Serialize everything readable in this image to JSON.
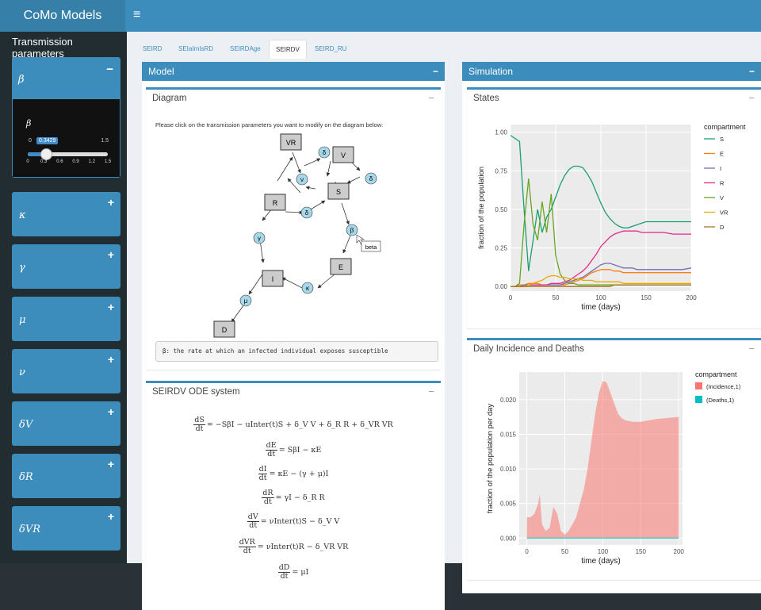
{
  "app": {
    "title": "CoMo Models",
    "menu_icon": "hamburger-icon"
  },
  "sidebar": {
    "title": "Transmission parameters",
    "beta": {
      "symbol": "β",
      "toggle": "−",
      "slider": {
        "label": "β",
        "min": "0",
        "max": "1.5",
        "value": 0.3429,
        "value_label": "0.3429",
        "ticks": [
          "0",
          "0.3",
          "0.6",
          "0.9",
          "1.2",
          "1.5"
        ]
      }
    },
    "params": [
      {
        "symbol": "κ",
        "toggle": "+"
      },
      {
        "symbol": "γ",
        "toggle": "+"
      },
      {
        "symbol": "μ",
        "toggle": "+"
      },
      {
        "symbol": "ν",
        "toggle": "+"
      },
      {
        "symbol": "δV",
        "toggle": "+"
      },
      {
        "symbol": "δR",
        "toggle": "+"
      },
      {
        "symbol": "δVR",
        "toggle": "+"
      }
    ]
  },
  "tabs": [
    {
      "label": "SEIRD",
      "active": false
    },
    {
      "label": "SEIaImIsRD",
      "active": false
    },
    {
      "label": "SEIRDAge",
      "active": false
    },
    {
      "label": "SEIRDV",
      "active": true
    },
    {
      "label": "SEIRD_RU",
      "active": false
    }
  ],
  "model": {
    "title": "Model",
    "toggle": "−",
    "diagram": {
      "title": "Diagram",
      "toggle": "−",
      "prompt": "Please click on the transmission parameters you want to modify on the diagram below:",
      "nodes": [
        "VR",
        "V",
        "S",
        "R",
        "E",
        "I",
        "D"
      ],
      "params": [
        "δ",
        "δ",
        "ν",
        "δ",
        "β",
        "γ",
        "κ",
        "μ"
      ],
      "tooltip": "beta",
      "description": "β: the rate at which an infected individual exposes susceptible"
    },
    "ode": {
      "title": "SEIRDV ODE system",
      "toggle": "−",
      "equations": [
        {
          "num": "dS",
          "den": "dt",
          "rhs": "= −SβI − uInter(t)S + δ_V V + δ_R R + δ_VR VR"
        },
        {
          "num": "dE",
          "den": "dt",
          "rhs": "= SβI − κE"
        },
        {
          "num": "dI",
          "den": "dt",
          "rhs": "= κE − (γ + μ)I"
        },
        {
          "num": "dR",
          "den": "dt",
          "rhs": "= γI − δ_R R"
        },
        {
          "num": "dV",
          "den": "dt",
          "rhs": "= νInter(t)S − δ_V V"
        },
        {
          "num": "dVR",
          "den": "dt",
          "rhs": "= νInter(t)R − δ_VR VR"
        },
        {
          "num": "dD",
          "den": "dt",
          "rhs": "= μI"
        }
      ]
    }
  },
  "simulation": {
    "title": "Simulation",
    "toggle": "−"
  },
  "chart_data": [
    {
      "type": "line",
      "title": "States",
      "xlabel": "time (days)",
      "ylabel": "fraction of the population",
      "xlim": [
        0,
        200
      ],
      "ylim": [
        -0.03,
        1.05
      ],
      "xticks": [
        "0",
        "50",
        "100",
        "150",
        "200"
      ],
      "yticks": [
        "0.00",
        "0.25",
        "0.50",
        "0.75",
        "1.00"
      ],
      "legend_title": "compartment",
      "legend_position": "right",
      "grid": true,
      "x": [
        0,
        5,
        10,
        15,
        20,
        25,
        30,
        35,
        40,
        45,
        50,
        55,
        60,
        65,
        70,
        75,
        80,
        85,
        90,
        95,
        100,
        105,
        110,
        115,
        120,
        125,
        130,
        135,
        140,
        145,
        150,
        160,
        170,
        180,
        190,
        200
      ],
      "series": [
        {
          "name": "S",
          "color": "#1b9e77",
          "values": [
            0.98,
            0.96,
            0.94,
            0.5,
            0.1,
            0.3,
            0.5,
            0.35,
            0.45,
            0.5,
            0.58,
            0.66,
            0.72,
            0.76,
            0.78,
            0.78,
            0.77,
            0.73,
            0.68,
            0.61,
            0.54,
            0.48,
            0.44,
            0.41,
            0.39,
            0.38,
            0.38,
            0.39,
            0.4,
            0.41,
            0.42,
            0.42,
            0.42,
            0.42,
            0.42,
            0.42
          ]
        },
        {
          "name": "E",
          "color": "#ff7f0e",
          "values": [
            0.0,
            0.0,
            0.01,
            0.01,
            0.02,
            0.02,
            0.02,
            0.01,
            0.01,
            0.01,
            0.01,
            0.01,
            0.01,
            0.02,
            0.03,
            0.04,
            0.05,
            0.07,
            0.09,
            0.1,
            0.11,
            0.11,
            0.11,
            0.1,
            0.1,
            0.09,
            0.09,
            0.09,
            0.09,
            0.09,
            0.09,
            0.09,
            0.09,
            0.09,
            0.09,
            0.09
          ]
        },
        {
          "name": "I",
          "color": "#7570b3",
          "values": [
            0.0,
            0.0,
            0.0,
            0.01,
            0.01,
            0.01,
            0.01,
            0.01,
            0.01,
            0.01,
            0.01,
            0.01,
            0.02,
            0.03,
            0.04,
            0.05,
            0.06,
            0.08,
            0.1,
            0.12,
            0.14,
            0.15,
            0.15,
            0.14,
            0.13,
            0.12,
            0.12,
            0.12,
            0.11,
            0.11,
            0.11,
            0.11,
            0.11,
            0.11,
            0.11,
            0.12
          ]
        },
        {
          "name": "R",
          "color": "#e7298a",
          "values": [
            0.0,
            0.0,
            0.0,
            0.0,
            0.01,
            0.01,
            0.01,
            0.01,
            0.01,
            0.02,
            0.02,
            0.02,
            0.03,
            0.04,
            0.06,
            0.08,
            0.1,
            0.13,
            0.17,
            0.21,
            0.26,
            0.29,
            0.32,
            0.34,
            0.35,
            0.36,
            0.36,
            0.36,
            0.36,
            0.35,
            0.35,
            0.35,
            0.35,
            0.34,
            0.34,
            0.34
          ]
        },
        {
          "name": "V",
          "color": "#66a61e",
          "values": [
            0.0,
            0.0,
            0.02,
            0.4,
            0.7,
            0.4,
            0.3,
            0.55,
            0.35,
            0.6,
            0.2,
            0.08,
            0.04,
            0.02,
            0.02,
            0.01,
            0.01,
            0.01,
            0.01,
            0.01,
            0.01,
            0.01,
            0.01,
            0.01,
            0.01,
            0.01,
            0.01,
            0.01,
            0.01,
            0.01,
            0.01,
            0.01,
            0.01,
            0.01,
            0.01,
            0.01
          ]
        },
        {
          "name": "VR",
          "color": "#e6ab02",
          "values": [
            0.0,
            0.0,
            0.0,
            0.0,
            0.01,
            0.02,
            0.03,
            0.04,
            0.06,
            0.07,
            0.07,
            0.06,
            0.06,
            0.05,
            0.05,
            0.05,
            0.04,
            0.04,
            0.04,
            0.03,
            0.03,
            0.03,
            0.03,
            0.03,
            0.03,
            0.02,
            0.02,
            0.02,
            0.02,
            0.02,
            0.02,
            0.02,
            0.02,
            0.02,
            0.02,
            0.02
          ]
        },
        {
          "name": "D",
          "color": "#a6761d",
          "values": [
            0.0,
            0.0,
            0.0,
            0.0,
            0.0,
            0.0,
            0.0,
            0.0,
            0.0,
            0.0,
            0.0,
            0.0,
            0.0,
            0.0,
            0.0,
            0.0,
            0.0,
            0.0,
            0.0,
            0.0,
            0.0,
            0.0,
            0.0,
            0.01,
            0.01,
            0.01,
            0.01,
            0.01,
            0.01,
            0.01,
            0.01,
            0.01,
            0.01,
            0.01,
            0.01,
            0.01
          ]
        }
      ]
    },
    {
      "type": "area",
      "title": "Daily Incidence and Deaths",
      "xlabel": "time (days)",
      "ylabel": "fraction of the population per day",
      "xlim": [
        -10,
        205
      ],
      "ylim": [
        -0.001,
        0.024
      ],
      "xticks": [
        "0",
        "50",
        "100",
        "150",
        "200"
      ],
      "yticks": [
        "0.000",
        "0.005",
        "0.010",
        "0.015",
        "0.020"
      ],
      "legend_title": "compartment",
      "legend_position": "right",
      "grid": true,
      "x": [
        0,
        5,
        10,
        15,
        17,
        20,
        25,
        30,
        35,
        40,
        45,
        50,
        55,
        60,
        65,
        70,
        75,
        80,
        85,
        90,
        95,
        100,
        105,
        110,
        115,
        120,
        125,
        130,
        140,
        150,
        160,
        170,
        180,
        190,
        200
      ],
      "series": [
        {
          "name": "(Incidence,1)",
          "color": "#f8766d",
          "values": [
            0.003,
            0.003,
            0.0035,
            0.005,
            0.0063,
            0.002,
            0.001,
            0.0015,
            0.0045,
            0.0035,
            0.001,
            0.0005,
            0.001,
            0.002,
            0.003,
            0.005,
            0.007,
            0.01,
            0.014,
            0.018,
            0.021,
            0.0227,
            0.0225,
            0.021,
            0.0195,
            0.018,
            0.0173,
            0.017,
            0.0168,
            0.0168,
            0.017,
            0.0172,
            0.0173,
            0.0174,
            0.0175
          ]
        },
        {
          "name": "(Deaths,1)",
          "color": "#00bfc4",
          "values": [
            0,
            0,
            0,
            0,
            0,
            0,
            0,
            0,
            0,
            0,
            0,
            0,
            0,
            0,
            0,
            0,
            0,
            0,
            0,
            0,
            0,
            0,
            0,
            0,
            0,
            0,
            0,
            0,
            0,
            0,
            0,
            0,
            0,
            0,
            0
          ]
        }
      ]
    }
  ]
}
